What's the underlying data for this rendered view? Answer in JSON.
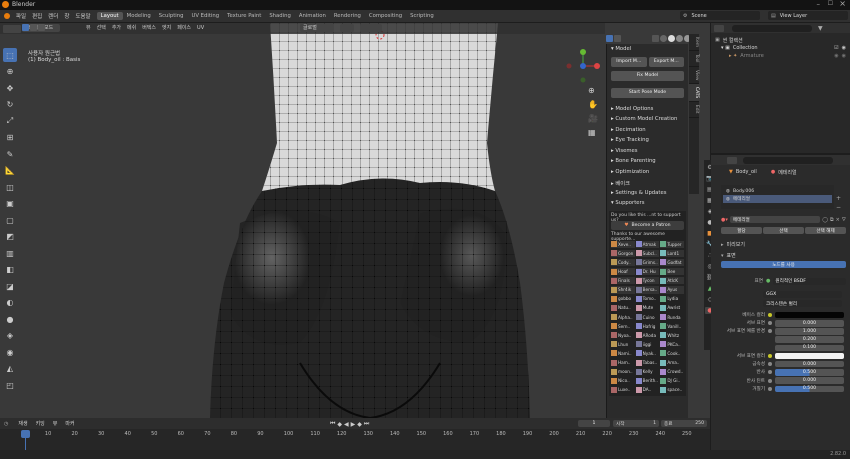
{
  "app": {
    "title": "Blender"
  },
  "menus": [
    "파일",
    "편집",
    "렌더",
    "창",
    "도움말"
  ],
  "workspaces": [
    "Layout",
    "Modeling",
    "Sculpting",
    "UV Editing",
    "Texture Paint",
    "Shading",
    "Animation",
    "Rendering",
    "Compositing",
    "Scripting"
  ],
  "scene": {
    "label": "Scene",
    "view_layer": "View Layer"
  },
  "viewport": {
    "mode": "오브젝트 모드",
    "header_menus": [
      "뷰",
      "선택",
      "추가",
      "메쉬",
      "버텍스",
      "엣지",
      "페이스",
      "UV"
    ],
    "view_name": "사용자 원근법",
    "object_info": "(1) Body_oil : Basis",
    "transform": "글로벌"
  },
  "npanel": {
    "model_title": "Model",
    "import_label": "Import M...",
    "export_label": "Export M...",
    "fix_label": "Fix Model",
    "pose_label": "Start Pose Mode",
    "sections": [
      "Model Options",
      "Custom Model Creation",
      "Decimation",
      "Eye Tracking",
      "Visemes",
      "Bone Parenting",
      "Optimization",
      "베이크",
      "Settings & Updates",
      "Supporters"
    ],
    "support_q": "Do you like this ...nt to support us?",
    "patron": "Become a Patron",
    "thanks": "Thanks to our awesome supporte...",
    "supporters": [
      "Xeve..",
      "Atmak",
      "Tupper",
      "Gorgon",
      "Subcl..",
      "Lord1",
      "Cody..",
      "Grims..",
      "Godfat",
      "Hoaf",
      "Dr. Hu",
      "Bee",
      "Finals",
      "Tycon",
      "AtlcK",
      "Shr4ik",
      "Bersa..",
      "Ayus",
      "gobbo",
      "Tomo..",
      "Lydia",
      "Natu..",
      "Mute",
      "Awrist",
      "Alpha..",
      "Cuino",
      "Runda",
      "Sern..",
      "Hafrig",
      "Vanill..",
      "Nyoa..",
      "ARoda",
      "Whitz",
      "Lhun",
      "iiggi",
      "PKCa..",
      "Nami..",
      "Nyak..",
      "Cook..",
      "Ham..",
      "Tabas..",
      "Ama..",
      "moon..",
      "Kelly",
      "Crowd..",
      "Nico..",
      "Berith..",
      "DJ Gi..",
      "Luxe..",
      "DA..",
      "space.."
    ]
  },
  "ntabs": [
    "Item",
    "Tool",
    "View",
    "CATS",
    "Edit"
  ],
  "outliner": {
    "title": "씬 컬렉션",
    "collection": "Collection",
    "armature": "Armature"
  },
  "properties": {
    "object": "Body_oil",
    "material_tab": "메테리얼",
    "slots": [
      "Body.006",
      "메테리얼"
    ],
    "material_name": "메테리얼",
    "assign": "할당",
    "select": "선택",
    "deselect": "선택 해제",
    "preview": "미리보기",
    "surface": "표면",
    "use_nodes": "노드를 사용",
    "surface_label": "표면",
    "shader": "원리적인 BSDF",
    "distribution": "GGX",
    "subsurface_method": "크리스텐슨 벌리",
    "rows": [
      {
        "label": "베이스 컬러",
        "value": ""
      },
      {
        "label": "서브 표면",
        "value": "0.000"
      },
      {
        "label": "서브 표면 예를 반경",
        "value": "1.000"
      },
      {
        "label": "",
        "value": "0.200"
      },
      {
        "label": "",
        "value": "0.100"
      },
      {
        "label": "서브 표면 컬러",
        "value": ""
      },
      {
        "label": "금속성",
        "value": "0.000"
      },
      {
        "label": "반사",
        "value": "0.500"
      },
      {
        "label": "반사 틴트",
        "value": "0.000"
      },
      {
        "label": "거칠기",
        "value": "0.500"
      }
    ]
  },
  "timeline": {
    "menus": [
      "재생",
      "키잉",
      "뷰",
      "마커"
    ],
    "current": "1",
    "start_label": "시작",
    "start": "1",
    "end_label": "종료",
    "end": "250",
    "ticks": [
      "1",
      "10",
      "20",
      "30",
      "40",
      "50",
      "60",
      "70",
      "80",
      "90",
      "100",
      "110",
      "120",
      "130",
      "140",
      "150",
      "160",
      "170",
      "180",
      "190",
      "200",
      "210",
      "220",
      "230",
      "240",
      "250"
    ]
  },
  "status": {
    "version": "2.82.0"
  },
  "colors": {
    "accent": "#4772b3",
    "viewport_bg": "#393939",
    "mesh_light": "#d9d9d9",
    "mesh_dark": "#1c1c1c"
  }
}
